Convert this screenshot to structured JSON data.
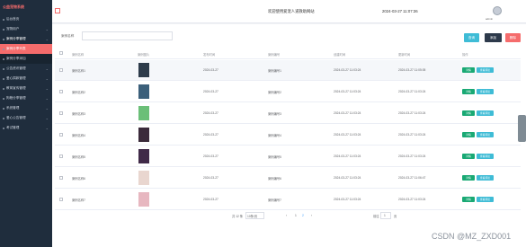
{
  "sidebar": {
    "logo": "公益宠物系统",
    "items": [
      {
        "label": "后台首页",
        "active": false,
        "sub": false
      },
      {
        "label": "宠物用户",
        "active": false,
        "sub": false
      },
      {
        "label": "案例分享管理",
        "active": true,
        "sub": false
      },
      {
        "label": "案例分享列表",
        "active": true,
        "sub": true
      },
      {
        "label": "案例分享添加",
        "active": false,
        "sub": true
      },
      {
        "label": "公告资讯管理",
        "active": false,
        "sub": false
      },
      {
        "label": "爱心捐款管理",
        "active": false,
        "sub": false
      },
      {
        "label": "教育宣传管理",
        "active": false,
        "sub": false
      },
      {
        "label": "狗粮分享管理",
        "active": false,
        "sub": false
      },
      {
        "label": "系统管理",
        "active": false,
        "sub": false
      },
      {
        "label": "爱心公告管理",
        "active": false,
        "sub": false
      },
      {
        "label": "考试管理",
        "active": false,
        "sub": false
      }
    ]
  },
  "header": {
    "title": "欢迎使用爱宠人道救助网站",
    "datetime": "2024-03-27 11:07:36",
    "user": "admin"
  },
  "toolbar": {
    "search_label": "案例名称",
    "search_placeholder": "",
    "search_button": "查询",
    "add_button": "添加",
    "delete_button": "删除"
  },
  "table": {
    "columns": [
      "案例名称",
      "案例图片",
      "发布时间",
      "案例编号",
      "创建时间",
      "更新时间",
      "操作"
    ],
    "rows": [
      {
        "name": "案例名称1",
        "date": "2024-03-27",
        "code": "案例编号1",
        "created": "2024-03-27 11:03:24",
        "updated": "2024-03-27 11:05:05",
        "thumb_color": "#2d3b4a"
      },
      {
        "name": "案例名称2",
        "date": "2024-03-27",
        "code": "案例编号2",
        "created": "2024-03-27 11:03:24",
        "updated": "2024-03-27 11:03:24",
        "thumb_color": "#3b5f7a"
      },
      {
        "name": "案例名称3",
        "date": "2024-03-27",
        "code": "案例编号3",
        "created": "2024-03-27 11:03:24",
        "updated": "2024-03-27 11:03:24",
        "thumb_color": "#6bbf78"
      },
      {
        "name": "案例名称4",
        "date": "2024-03-27",
        "code": "案例编号4",
        "created": "2024-03-27 11:03:24",
        "updated": "2024-03-27 11:03:24",
        "thumb_color": "#3a2a3a"
      },
      {
        "name": "案例名称5",
        "date": "2024-03-27",
        "code": "案例编号5",
        "created": "2024-03-27 11:03:24",
        "updated": "2024-03-27 11:03:24",
        "thumb_color": "#402a48"
      },
      {
        "name": "案例名称6",
        "date": "2024-03-27",
        "code": "案例编号6",
        "created": "2024-03-27 11:03:24",
        "updated": "2024-03-27 11:06:47",
        "thumb_color": "#e9d6cf"
      },
      {
        "name": "案例名称7",
        "date": "2024-03-27",
        "code": "案例编号7",
        "created": "2024-03-27 11:03:24",
        "updated": "2024-03-27 11:03:24",
        "thumb_color": "#e7b7c0"
      }
    ],
    "detail_label": "详情",
    "review_label": "查看评论"
  },
  "pager": {
    "total": "共 12 条",
    "page_size": "10条/页",
    "prev": "‹",
    "page1": "1",
    "page2": "2",
    "next": "›",
    "goto_label": "前往",
    "goto_value": "1",
    "page_unit": "页"
  },
  "watermark": "CSDN @MZ_ZXD001"
}
